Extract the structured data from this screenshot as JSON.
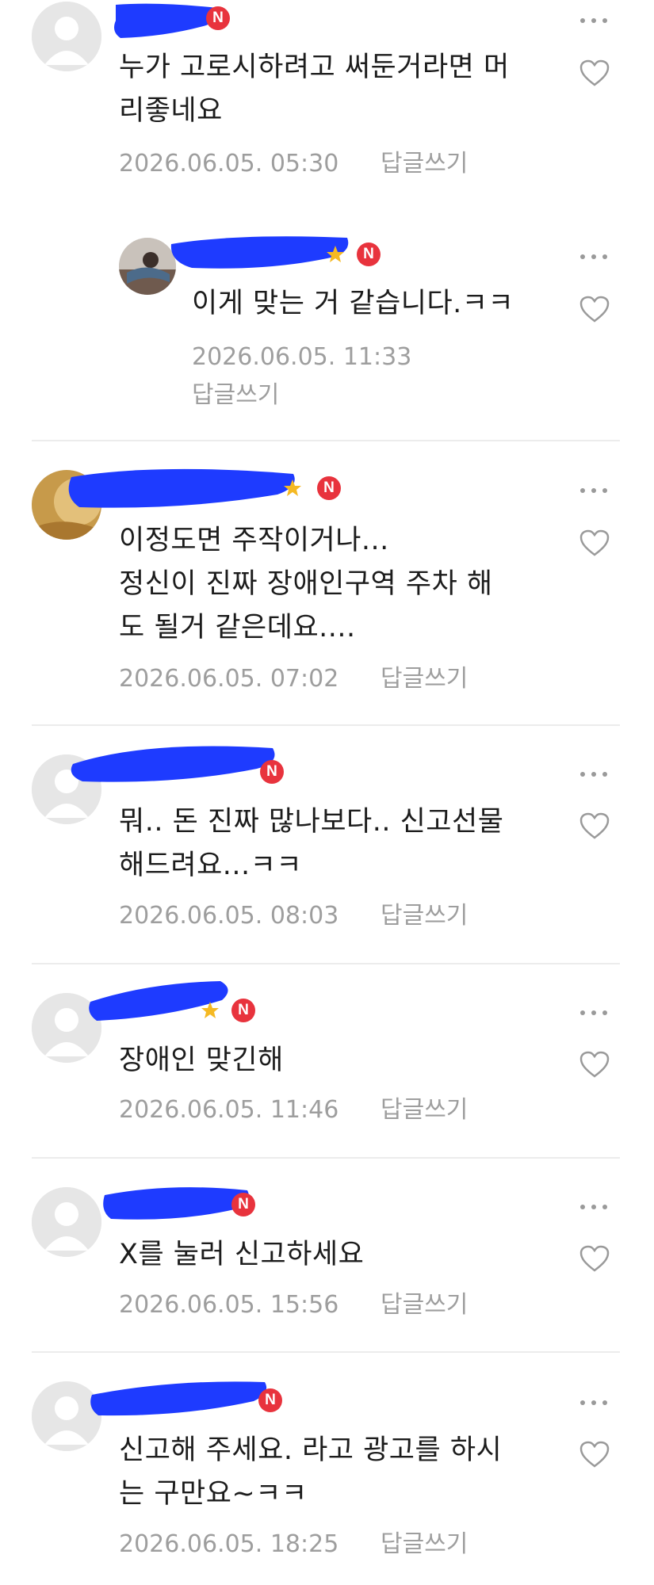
{
  "reply_label": "답글쓰기",
  "colors": {
    "badge": "#e8333d",
    "meta": "#9e9e9e",
    "scribble": "#1e3bff",
    "star": "#f5b923"
  },
  "icons": {
    "new_badge": "N",
    "more": "more-dots-icon",
    "like": "heart-icon",
    "grade": "star-icon"
  },
  "comments": [
    {
      "text": "누가 고로시하려고 써둔거라면 머\n리좋네요",
      "date": "2026.06.05. 05:30",
      "reply": "답글쓰기"
    },
    {
      "text": "이게 맞는 거 같습니다.ㅋㅋ",
      "date": "2026.06.05. 11:33",
      "reply": "답글쓰기",
      "is_reply": true
    },
    {
      "text": "이정도면 주작이거나...\n정신이 진짜 장애인구역 주차 해\n도 될거 같은데요....",
      "date": "2026.06.05. 07:02",
      "reply": "답글쓰기"
    },
    {
      "text": "뭐.. 돈 진짜 많나보다.. 신고선물\n해드려요...ㅋㅋ",
      "date": "2026.06.05. 08:03",
      "reply": "답글쓰기"
    },
    {
      "text": "장애인 맞긴해",
      "date": "2026.06.05. 11:46",
      "reply": "답글쓰기"
    },
    {
      "text": "X를 눌러 신고하세요",
      "date": "2026.06.05. 15:56",
      "reply": "답글쓰기"
    },
    {
      "text": "신고해 주세요. 라고 광고를 하시\n는 구만요~ㅋㅋ",
      "date": "2026.06.05. 18:25",
      "reply": "답글쓰기"
    }
  ]
}
